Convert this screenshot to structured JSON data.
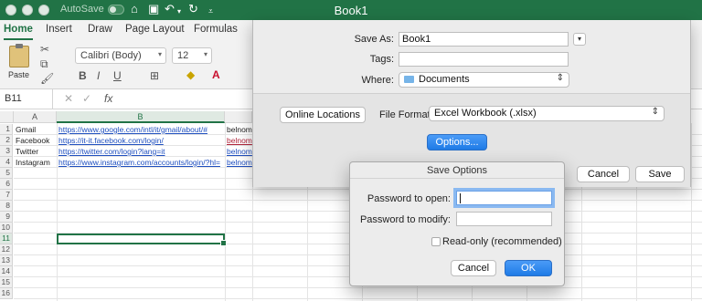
{
  "window": {
    "title": "Book1",
    "autosave_label": "AutoSave",
    "autosave_state": "OFF"
  },
  "ribbon": {
    "tabs": [
      "Home",
      "Insert",
      "Draw",
      "Page Layout",
      "Formulas"
    ],
    "paste_label": "Paste",
    "font_name": "Calibri (Body)",
    "font_size": "12"
  },
  "formula_bar": {
    "name_box": "B11",
    "fx_label": "fx"
  },
  "sheet": {
    "columns": [
      "A",
      "B"
    ],
    "rows": [
      "1",
      "2",
      "3",
      "4",
      "5",
      "6",
      "7",
      "8",
      "9",
      "10",
      "11",
      "12",
      "13",
      "14",
      "15",
      "16"
    ],
    "cells": [
      {
        "a": "Gmail",
        "b": "https://www.google.com/intl/it/gmail/about/#",
        "c": "belnom"
      },
      {
        "a": "Facebook",
        "b": "https://it-it.facebook.com/login/",
        "c": "belnom"
      },
      {
        "a": "Twitter",
        "b": "https://twitter.com/login?lang=it",
        "c": "belnom"
      },
      {
        "a": "Instagram",
        "b": "https://www.instagram.com/accounts/login/?hl=",
        "c": "belnom"
      }
    ],
    "selected_cell": "B11"
  },
  "save_as": {
    "save_as_label": "Save As:",
    "save_as_value": "Book1",
    "tags_label": "Tags:",
    "tags_value": "",
    "where_label": "Where:",
    "where_value": "Documents",
    "online_locations_button": "Online Locations",
    "file_format_label": "File Format:",
    "file_format_value": "Excel Workbook (.xlsx)",
    "options_button": "Options...",
    "cancel_button": "Cancel",
    "save_button": "Save"
  },
  "save_options": {
    "title": "Save Options",
    "password_open_label": "Password to open:",
    "password_open_value": "",
    "password_modify_label": "Password to modify:",
    "password_modify_value": "",
    "readonly_label": "Read-only (recommended)",
    "readonly_checked": false,
    "cancel_button": "Cancel",
    "ok_button": "OK"
  },
  "colors": {
    "excel_green": "#217346",
    "accent_blue": "#1f7be6",
    "link_blue": "#1f4fbf"
  }
}
